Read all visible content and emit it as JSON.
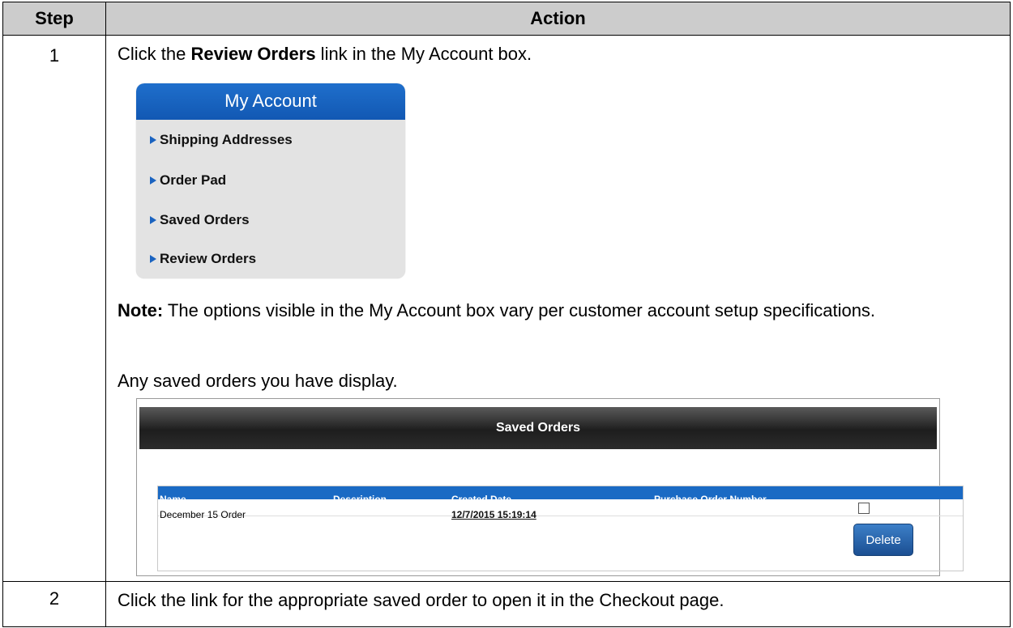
{
  "table": {
    "header_step": "Step",
    "header_action": "Action"
  },
  "step1": {
    "number": "1",
    "instruction_prefix": "Click the ",
    "instruction_bold": "Review Orders",
    "instruction_suffix": " link in the My Account box.",
    "my_account": {
      "title": "My Account",
      "items": [
        {
          "label": "Shipping Addresses"
        },
        {
          "label": "Order Pad"
        },
        {
          "label": "Saved Orders"
        },
        {
          "label": "Review Orders"
        }
      ]
    },
    "note_label": "Note:",
    "note_text": " The options visible in the My Account box vary per customer account setup specifications.",
    "result_text": "Any saved orders you have display.",
    "saved_orders": {
      "title": "Saved Orders",
      "columns": [
        "Name",
        "Description",
        "Created Date",
        "Purchase Order Number"
      ],
      "rows": [
        {
          "name": "December 15 Order",
          "description": "",
          "created_date": "12/7/2015 15:19:14",
          "po_number": ""
        }
      ],
      "delete_label": "Delete"
    }
  },
  "step2": {
    "number": "2",
    "instruction": "Click the link for the appropriate saved order to open it in the Checkout page."
  },
  "colors": {
    "header_bg": "#cccccc",
    "account_blue": "#1a63c0",
    "table_header_blue": "#1a6ac4"
  }
}
